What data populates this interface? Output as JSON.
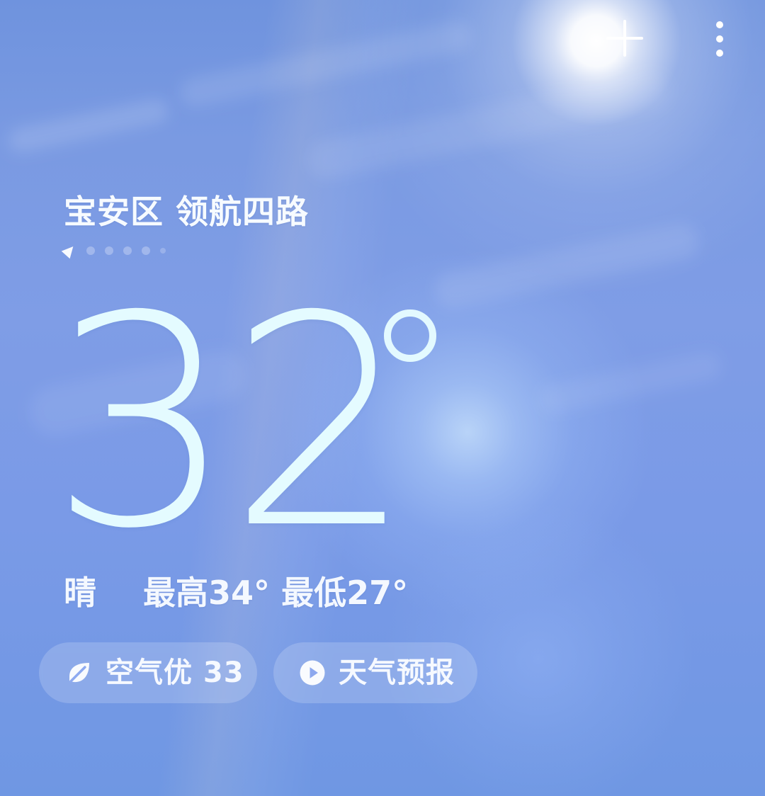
{
  "toolbar": {
    "add_icon": "plus-icon",
    "more_icon": "more-vertical-icon"
  },
  "location": {
    "name": "宝安区 领航四路"
  },
  "pager": {
    "current_icon": "location-arrow-icon",
    "dot_count": 5
  },
  "weather": {
    "temperature": "32",
    "summary_condition": "晴",
    "high": "最高34°",
    "low": "最低27°"
  },
  "chips": {
    "air_quality": {
      "label": "空气优 33",
      "icon": "leaf-icon"
    },
    "forecast": {
      "label": "天气预报",
      "icon": "play-circle-icon"
    }
  },
  "colors": {
    "text_primary": "#f7fbff",
    "temperature": "#e4fbff",
    "sky_blue": "#7f9de6"
  }
}
